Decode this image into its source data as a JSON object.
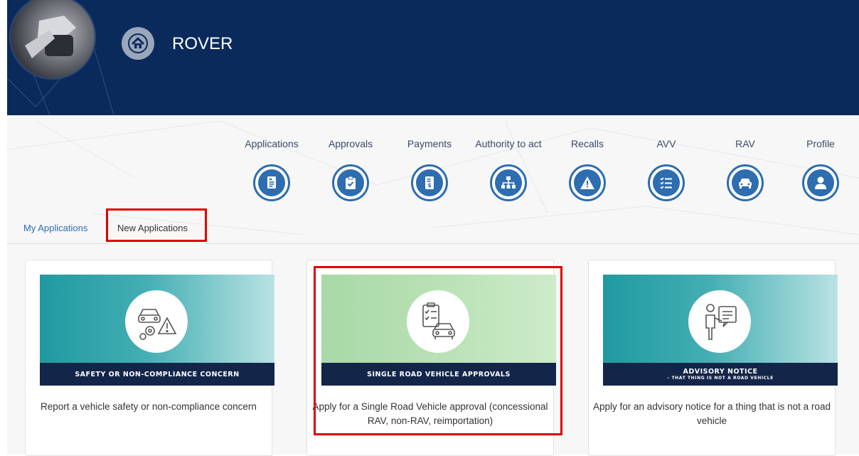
{
  "header": {
    "app_title": "ROVER",
    "home_icon": "home-icon",
    "colors": {
      "banner": "#0b2a5c",
      "accent": "#2d6db0",
      "highlight": "#e00000"
    }
  },
  "nav": {
    "items": [
      {
        "label": "Applications",
        "icon": "document-icon"
      },
      {
        "label": "Approvals",
        "icon": "clipboard-check-icon"
      },
      {
        "label": "Payments",
        "icon": "invoice-dollar-icon"
      },
      {
        "label": "Authority to act",
        "icon": "org-chart-icon"
      },
      {
        "label": "Recalls",
        "icon": "warning-icon"
      },
      {
        "label": "AVV",
        "icon": "checklist-icon"
      },
      {
        "label": "RAV",
        "icon": "car-icon"
      },
      {
        "label": "Profile",
        "icon": "user-icon"
      }
    ]
  },
  "tabs": {
    "my_applications": "My Applications",
    "new_applications": "New Applications",
    "active": "New Applications"
  },
  "cards": [
    {
      "band_title": "SAFETY OR NON-COMPLIANCE CONCERN",
      "description": "Report a vehicle safety or non-compliance concern",
      "icon": "car-gears-warning-icon"
    },
    {
      "band_title": "SINGLE ROAD VEHICLE APPROVALS",
      "description": "Apply for a Single Road Vehicle approval (concessional RAV, non-RAV, reimportation)",
      "icon": "checklist-car-icon"
    },
    {
      "band_title": "ADVISORY NOTICE",
      "band_subtitle": "– THAT THING IS NOT A ROAD VEHICLE",
      "description": "Apply for an advisory notice for a thing that is not a road vehicle",
      "icon": "presenter-icon"
    }
  ]
}
